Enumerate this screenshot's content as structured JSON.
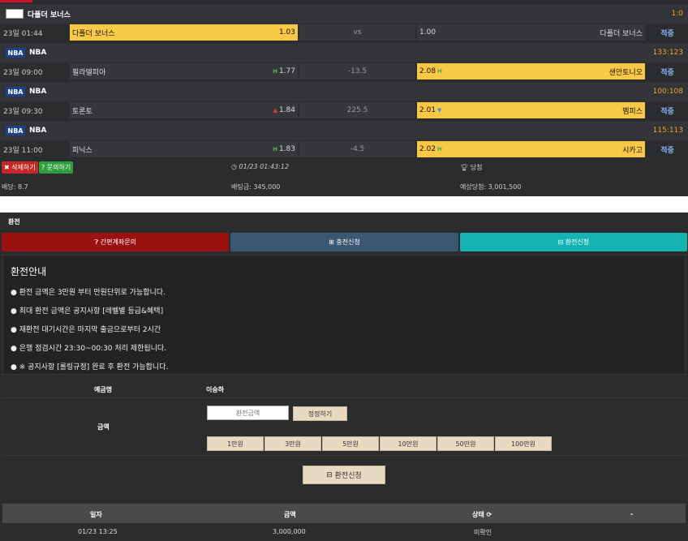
{
  "leagues": [
    {
      "name": "다폴더 보너스",
      "score": "1:0",
      "logo": "broken-image",
      "games": [
        {
          "time": "23일 01:44",
          "home": "다폴더 보너스",
          "home_odds": "1.03",
          "mid": "vs",
          "away": "다폴더 보너스",
          "away_odds": "1.00",
          "status": "적중",
          "pick": "home",
          "home_icon": "",
          "away_icon": ""
        }
      ]
    },
    {
      "name": "NBA",
      "score": "133:123",
      "logo": "nba",
      "games": [
        {
          "time": "23일 09:00",
          "home": "필라델피아",
          "home_odds": "1.77",
          "mid": "-13.5",
          "away": "샌안토니오",
          "away_odds": "2.08",
          "status": "적중",
          "pick": "away",
          "home_icon": "H",
          "away_icon": "H"
        }
      ]
    },
    {
      "name": "NBA",
      "score": "100:108",
      "logo": "nba",
      "games": [
        {
          "time": "23일 09:30",
          "home": "토론토",
          "home_odds": "1.84",
          "mid": "225.5",
          "away": "멤피스",
          "away_odds": "2.01",
          "status": "적중",
          "pick": "away",
          "home_icon": "▲",
          "away_icon": "▼"
        }
      ]
    },
    {
      "name": "NBA",
      "score": "115:113",
      "logo": "nba",
      "games": [
        {
          "time": "23일 11:00",
          "home": "피닉스",
          "home_odds": "1.83",
          "mid": "-4.5",
          "away": "시카고",
          "away_odds": "2.02",
          "status": "적중",
          "pick": "away",
          "home_icon": "H",
          "away_icon": "H"
        }
      ]
    }
  ],
  "footer": {
    "delete_label": "삭제하기",
    "inquiry_label": "문의하기",
    "datetime": "01/23 01:43:12",
    "result": "당첨",
    "odds": "배당: 8.7",
    "stake": "배팅금: 345,000",
    "expected": "예상당첨: 3,001,500"
  },
  "exchange": {
    "title": "환전",
    "tabs": [
      "간편계좌문의",
      "충전신청",
      "환전신청"
    ],
    "guide_title": "환전안내",
    "guide": [
      "● 환전 금액은 3만원 부터 만원단위로 가능합니다.",
      "● 최대 환전 금액은 공지사항 [레벨별 등급&혜택]",
      "● 재환전 대기시간은 마지막 출금으로부터 2시간",
      "● 은행 점검시간 23:30~00:30 처리 제한됩니다.",
      "● ※ 공지사항 [롤링규정] 완료 후 환전 가능합니다."
    ],
    "depositor_label": "예금명",
    "depositor_value": "이승하",
    "amount_label": "금액",
    "amount_placeholder": "환전금액",
    "reset_label": "정정하기",
    "amounts": [
      "1만원",
      "3만원",
      "5만원",
      "10만원",
      "50만원",
      "100만원"
    ],
    "submit_label": "환전신청",
    "history_headers": [
      "일자",
      "금액",
      "상태",
      "-"
    ],
    "history": [
      {
        "date": "01/23 13:25",
        "amount": "3,000,000",
        "status": "미확인"
      }
    ]
  },
  "colors": {
    "highlight": "#f9c846",
    "tab_red": "#9b1010",
    "tab_blue": "#3b5872",
    "tab_teal": "#16b3b3",
    "score": "#e6a232",
    "status": "#8ab4f8"
  }
}
